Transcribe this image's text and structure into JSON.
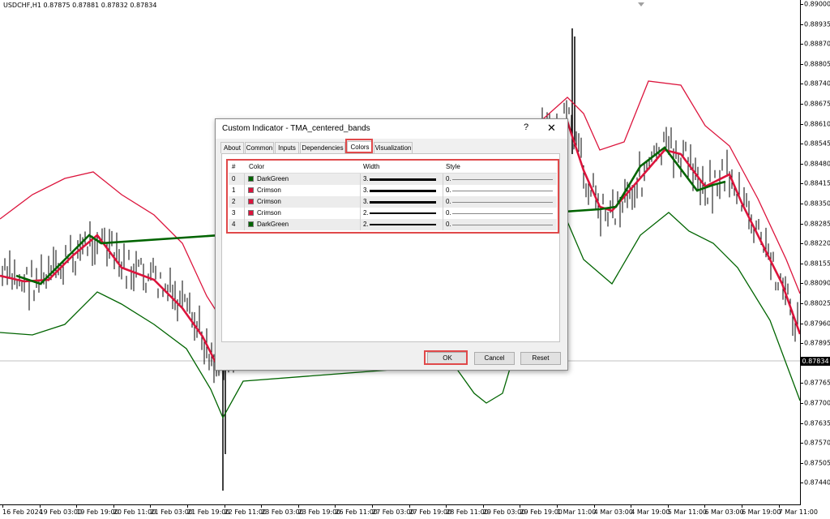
{
  "chart": {
    "title": "USDCHF,H1  0.87875 0.87881 0.87832 0.87834",
    "current_price": "0.87834",
    "y_labels": [
      "0.89000",
      "0.88935",
      "0.88870",
      "0.88805",
      "0.88740",
      "0.88675",
      "0.88610",
      "0.88545",
      "0.88480",
      "0.88415",
      "0.88350",
      "0.88285",
      "0.88220",
      "0.88155",
      "0.88090",
      "0.88025",
      "0.87960",
      "0.87895",
      "0.87830",
      "0.87765",
      "0.87700",
      "0.87635",
      "0.87570",
      "0.87505",
      "0.87440"
    ],
    "x_labels": [
      "16 Feb 2024",
      "19 Feb 03:00",
      "19 Feb 19:00",
      "20 Feb 11:00",
      "21 Feb 03:00",
      "21 Feb 19:00",
      "22 Feb 11:00",
      "23 Feb 03:00",
      "23 Feb 19:00",
      "26 Feb 11:00",
      "27 Feb 03:00",
      "27 Feb 19:00",
      "28 Feb 11:00",
      "29 Feb 03:00",
      "29 Feb 19:00",
      "1 Mar 11:00",
      "4 Mar 03:00",
      "4 Mar 19:00",
      "5 Mar 11:00",
      "6 Mar 03:00",
      "6 Mar 19:00",
      "7 Mar 11:00"
    ],
    "colors": {
      "upper_band": "#dc143c",
      "lower_band": "#006400",
      "center": "#dc143c",
      "center_up": "#006400",
      "candles": "#000000"
    }
  },
  "dialog": {
    "title": "Custom Indicator - TMA_centered_bands",
    "help_label": "?",
    "close_label": "✕",
    "tabs": [
      "About",
      "Common",
      "Inputs",
      "Dependencies",
      "Colors",
      "Visualization"
    ],
    "active_tab": "Colors",
    "grid": {
      "headers": {
        "index": "#",
        "color": "Color",
        "width": "Width",
        "style": "Style"
      },
      "rows": [
        {
          "index": "0",
          "color_name": "DarkGreen",
          "swatch": "#006400",
          "width": "3.",
          "style": "0."
        },
        {
          "index": "1",
          "color_name": "Crimson",
          "swatch": "#dc143c",
          "width": "3.",
          "style": "0."
        },
        {
          "index": "2",
          "color_name": "Crimson",
          "swatch": "#dc143c",
          "width": "3.",
          "style": "0."
        },
        {
          "index": "3",
          "color_name": "Crimson",
          "swatch": "#dc143c",
          "width": "2.",
          "style": "0."
        },
        {
          "index": "4",
          "color_name": "DarkGreen",
          "swatch": "#006400",
          "width": "2.",
          "style": "0."
        }
      ]
    },
    "buttons": {
      "ok": "OK",
      "cancel": "Cancel",
      "reset": "Reset"
    },
    "highlight_color": "#e0494a"
  }
}
